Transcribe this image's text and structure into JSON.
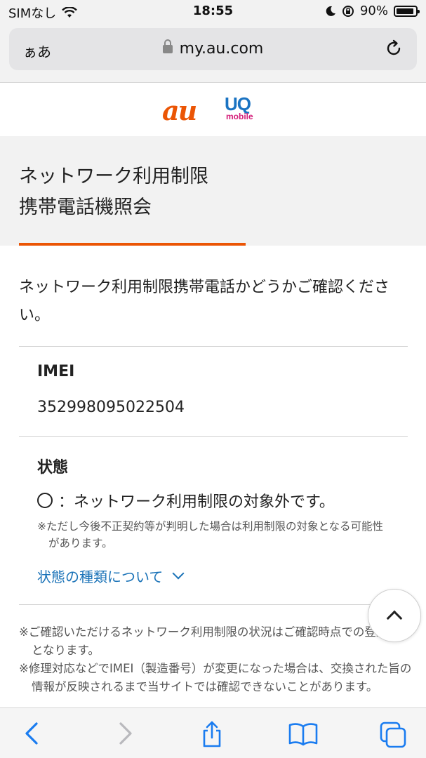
{
  "status_bar": {
    "carrier": "SIMなし",
    "time": "18:55",
    "battery": "90%"
  },
  "address_bar": {
    "aa_label": "ぁあ",
    "url": "my.au.com"
  },
  "logos": {
    "au": "au",
    "uq_top": "UQ",
    "uq_bottom": "mobile"
  },
  "page": {
    "title_line1": "ネットワーク利用制限",
    "title_line2": "携帯電話機照会",
    "intro": "ネットワーク利用制限携帯電話かどうかご確認ください。",
    "imei_label": "IMEI",
    "imei_value": "352998095022504",
    "status_label": "状態",
    "status_value": "：ネットワーク利用制限の対象外です。",
    "status_note": "※ただし今後不正契約等が判明した場合は利用制限の対象となる可能性があります。",
    "status_types_link": "状態の種類について",
    "bottom_note_1": "※ご確認いただけるネットワーク利用制限の状況はご確認時点での登録状況となります。",
    "bottom_note_2": "※修理対応などでIMEI（製造番号）が変更になった場合は、交換された旨の情報が反映されるまで当サイトでは確認できないことがあります。"
  },
  "colors": {
    "accent": "#eb5505",
    "link": "#1b73b8",
    "toolbar_icon": "#1a7cf0"
  }
}
